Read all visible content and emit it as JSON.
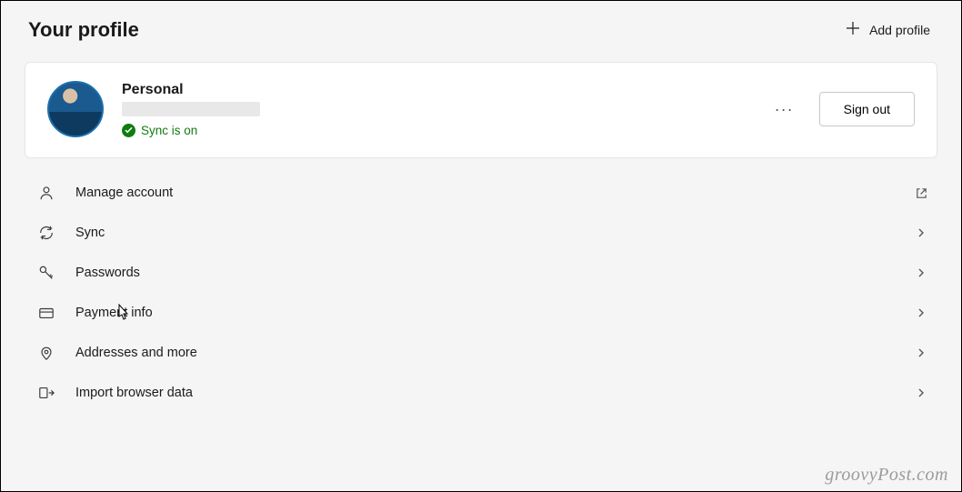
{
  "header": {
    "title": "Your profile",
    "add_profile_label": "Add profile"
  },
  "profile": {
    "name": "Personal",
    "sync_status": "Sync is on",
    "more_label": "···",
    "signout_label": "Sign out"
  },
  "menu": {
    "items": [
      {
        "label": "Manage account",
        "icon": "person-icon",
        "action": "external"
      },
      {
        "label": "Sync",
        "icon": "sync-icon",
        "action": "chevron"
      },
      {
        "label": "Passwords",
        "icon": "key-icon",
        "action": "chevron"
      },
      {
        "label": "Payment info",
        "icon": "card-icon",
        "action": "chevron"
      },
      {
        "label": "Addresses and more",
        "icon": "location-icon",
        "action": "chevron"
      },
      {
        "label": "Import browser data",
        "icon": "import-icon",
        "action": "chevron"
      }
    ]
  },
  "watermark": "groovyPost.com"
}
